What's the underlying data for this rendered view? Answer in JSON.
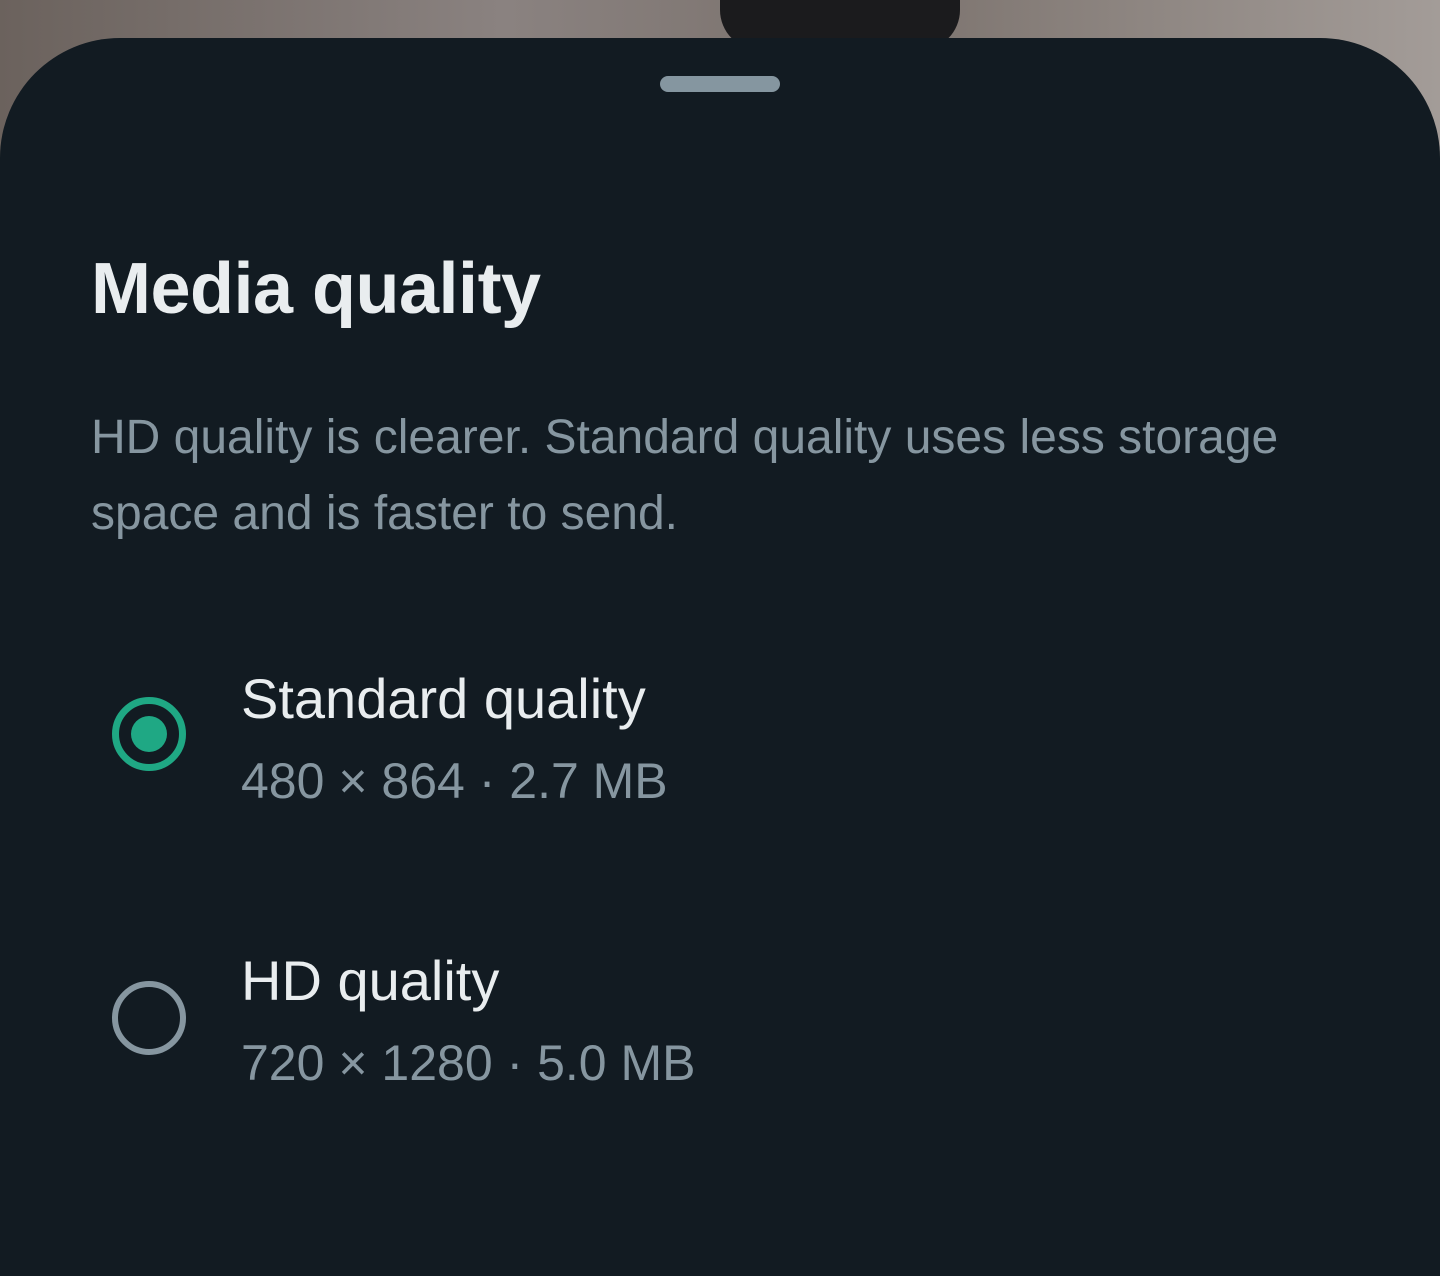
{
  "sheet": {
    "title": "Media quality",
    "description": "HD quality is clearer. Standard quality uses less storage space and is faster to send."
  },
  "options": [
    {
      "label": "Standard quality",
      "detail": "480 × 864 · 2.7 MB",
      "selected": true
    },
    {
      "label": "HD quality",
      "detail": "720 × 1280 · 5.0 MB",
      "selected": false
    }
  ],
  "colors": {
    "sheet_background": "#121b22",
    "accent": "#1fa884",
    "primary_text": "#e9edef",
    "secondary_text": "#8696a0"
  }
}
